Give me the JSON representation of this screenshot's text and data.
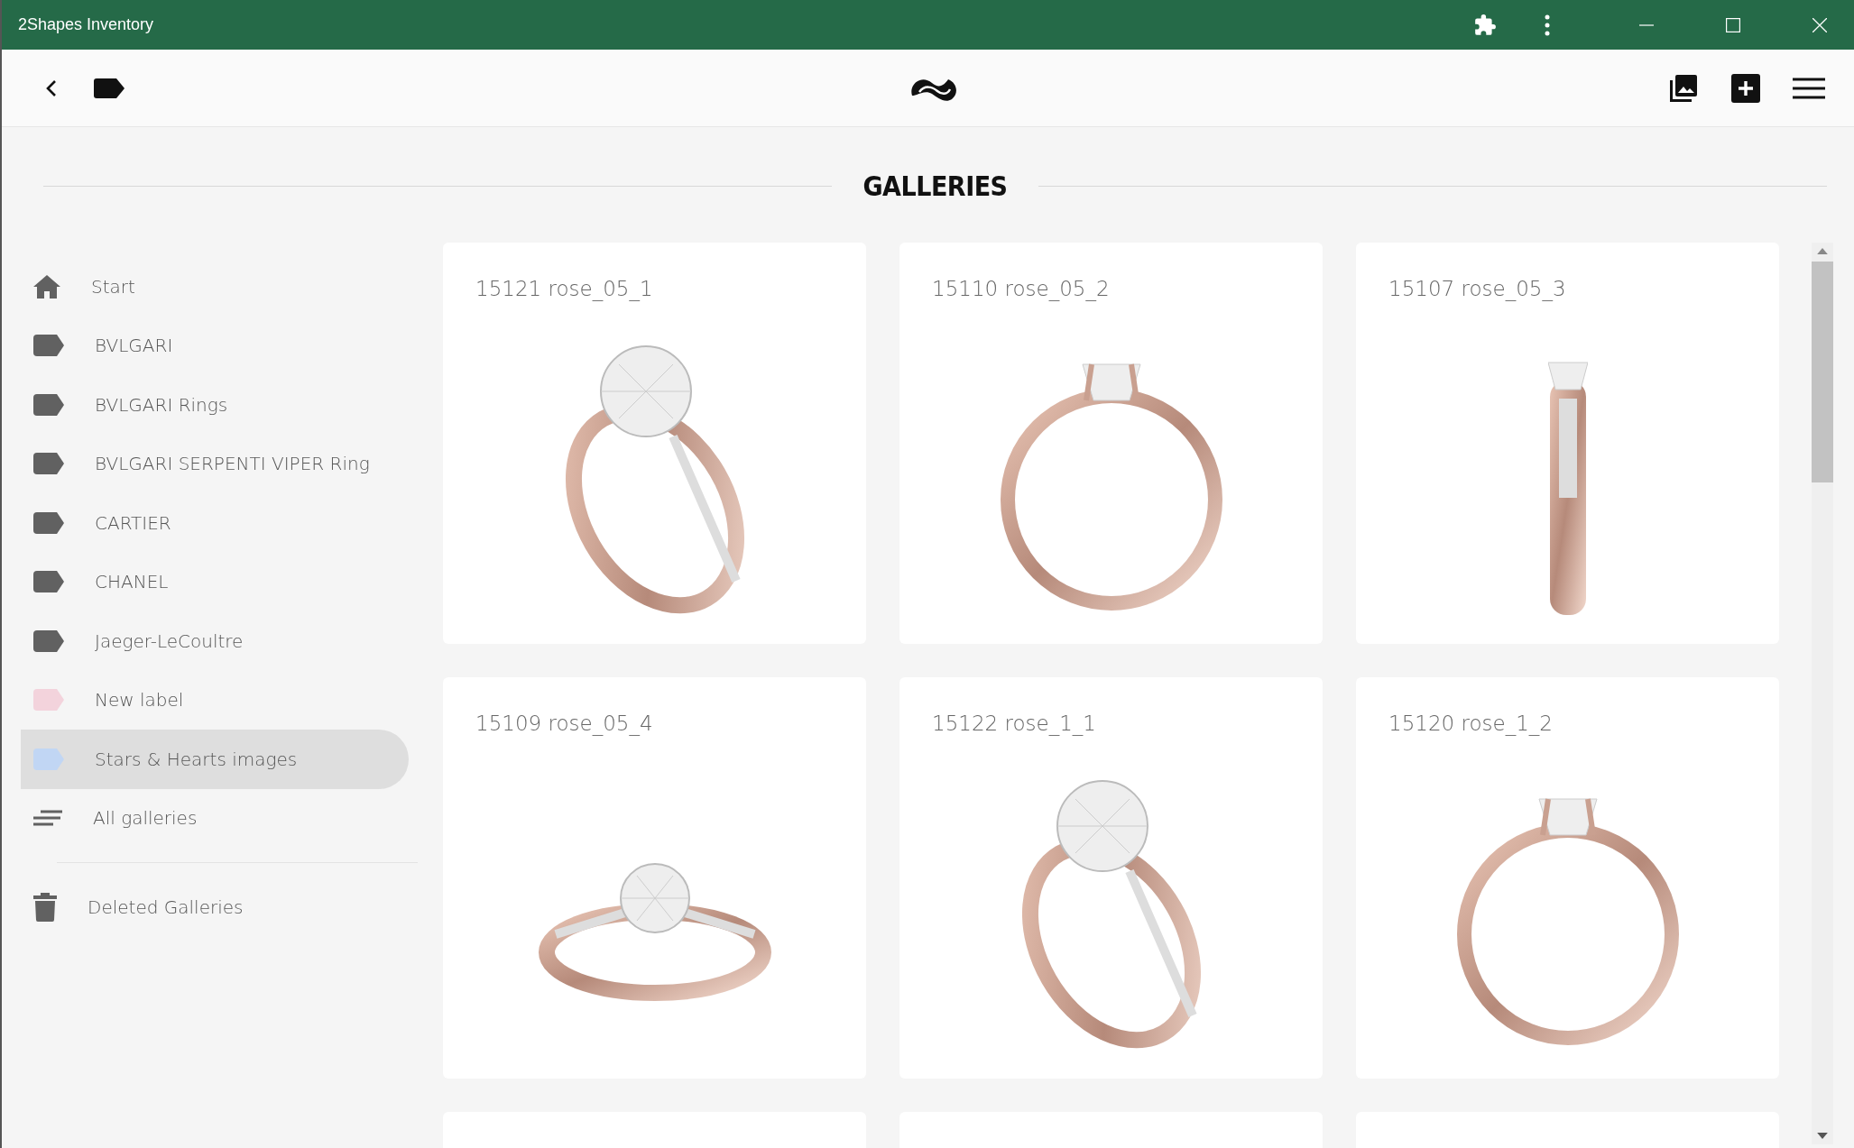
{
  "window": {
    "title": "2Shapes Inventory"
  },
  "page_title": "GALLERIES",
  "sidebar": {
    "items": [
      {
        "kind": "home",
        "label": "Start",
        "selected": false
      },
      {
        "kind": "label",
        "label": "BVLGARI",
        "color": "#616161",
        "selected": false
      },
      {
        "kind": "label",
        "label": "BVLGARI Rings",
        "color": "#616161",
        "selected": false
      },
      {
        "kind": "label",
        "label": "BVLGARI SERPENTI VIPER Ring",
        "color": "#616161",
        "selected": false
      },
      {
        "kind": "label",
        "label": "CARTIER",
        "color": "#616161",
        "selected": false
      },
      {
        "kind": "label",
        "label": "CHANEL",
        "color": "#616161",
        "selected": false
      },
      {
        "kind": "label",
        "label": "Jaeger-LeCoultre",
        "color": "#616161",
        "selected": false
      },
      {
        "kind": "label",
        "label": "New label",
        "color": "#f3d3dc",
        "selected": false
      },
      {
        "kind": "label",
        "label": "Stars & Hearts images",
        "color": "#c1d6f4",
        "selected": true
      },
      {
        "kind": "list",
        "label": "All galleries",
        "selected": false
      },
      {
        "kind": "trash",
        "label": "Deleted Galleries",
        "selected": false
      }
    ]
  },
  "galleries": [
    {
      "kind": "angled",
      "title": "15121 rose_05_1"
    },
    {
      "kind": "front",
      "title": "15110 rose_05_2"
    },
    {
      "kind": "side",
      "title": "15107 rose_05_3"
    },
    {
      "kind": "top",
      "title": "15109 rose_05_4"
    },
    {
      "kind": "angled",
      "title": "15122 rose_1_1"
    },
    {
      "kind": "front",
      "title": "15120 rose_1_2"
    },
    {
      "kind": "clipped"
    },
    {
      "kind": "clipped"
    },
    {
      "kind": "clipped"
    }
  ]
}
